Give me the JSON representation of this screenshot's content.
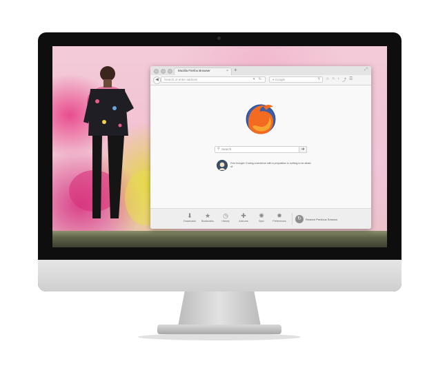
{
  "browser": {
    "tab_title": "Mozilla Firefox Browser",
    "tab_close": "×",
    "new_tab": "+",
    "url_placeholder": "Search or enter address",
    "url_icons": "▾ ↻",
    "search_engine": "Google",
    "toolbar_icons": [
      "☆",
      "⌂",
      "↓",
      "⤴",
      "☰"
    ]
  },
  "newtab_page": {
    "search_placeholder": "Search",
    "search_go": "➔",
    "snippet_text": "Free thought: Ending a sentence with a preposition is nothing to be afraid of."
  },
  "launcher": {
    "items": [
      {
        "label": "Downloads",
        "icon": "download-icon",
        "glyph": "⬇"
      },
      {
        "label": "Bookmarks",
        "icon": "star-icon",
        "glyph": "★"
      },
      {
        "label": "History",
        "icon": "clock-icon",
        "glyph": "◷"
      },
      {
        "label": "Add-ons",
        "icon": "puzzle-icon",
        "glyph": "✚"
      },
      {
        "label": "Sync",
        "icon": "sync-icon",
        "glyph": "✺"
      },
      {
        "label": "Preferences",
        "icon": "gear-icon",
        "glyph": "✹"
      }
    ],
    "restore_label": "Restore Previous Session",
    "restore_glyph": "↻"
  },
  "colors": {
    "firefox_orange": "#f26b21",
    "firefox_globe": "#3b5ea8",
    "monitor_bezel": "#0e0e0e"
  }
}
